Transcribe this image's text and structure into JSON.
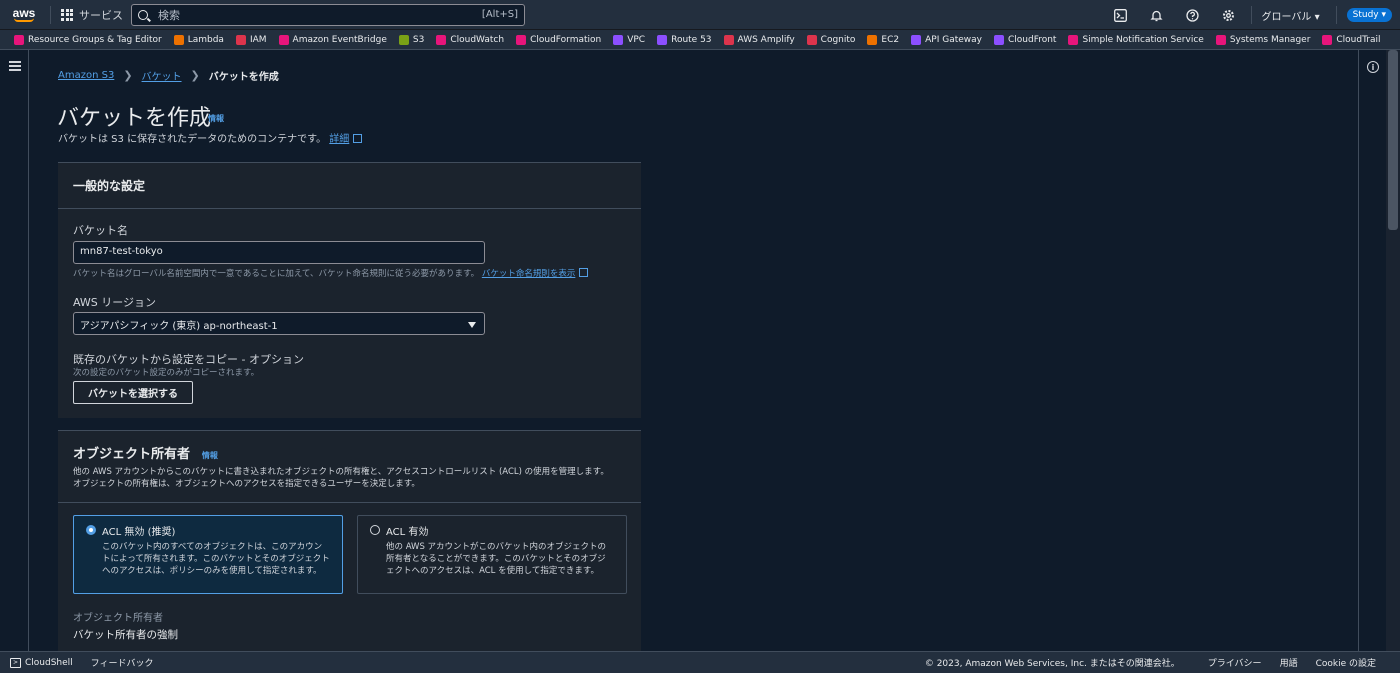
{
  "topnav": {
    "logo": "aws",
    "services_label": "サービス",
    "search_placeholder": "検索",
    "search_shortcut": "[Alt+S]",
    "region": "グローバル ▾",
    "account": "Study ▾",
    "icons": [
      "cloudshell-icon",
      "bell-icon",
      "help-icon",
      "gear-icon"
    ]
  },
  "favorites": [
    {
      "label": "Resource Groups & Tag Editor",
      "color": "#e7157b"
    },
    {
      "label": "Lambda",
      "color": "#ed7100"
    },
    {
      "label": "IAM",
      "color": "#dd344c"
    },
    {
      "label": "Amazon EventBridge",
      "color": "#e7157b"
    },
    {
      "label": "S3",
      "color": "#7aa116"
    },
    {
      "label": "CloudWatch",
      "color": "#e7157b"
    },
    {
      "label": "CloudFormation",
      "color": "#e7157b"
    },
    {
      "label": "VPC",
      "color": "#8c4fff"
    },
    {
      "label": "Route 53",
      "color": "#8c4fff"
    },
    {
      "label": "AWS Amplify",
      "color": "#dd344c"
    },
    {
      "label": "Cognito",
      "color": "#dd344c"
    },
    {
      "label": "EC2",
      "color": "#ed7100"
    },
    {
      "label": "API Gateway",
      "color": "#8c4fff"
    },
    {
      "label": "CloudFront",
      "color": "#8c4fff"
    },
    {
      "label": "Simple Notification Service",
      "color": "#e7157b"
    },
    {
      "label": "Systems Manager",
      "color": "#e7157b"
    },
    {
      "label": "CloudTrail",
      "color": "#e7157b"
    }
  ],
  "breadcrumb": {
    "s3": "Amazon S3",
    "bucket": "バケット",
    "current": "バケットを作成"
  },
  "page": {
    "title": "バケットを作成",
    "info": "情報",
    "desc": "バケットは S3 に保存されたデータのためのコンテナです。",
    "desc_link": "詳細"
  },
  "general": {
    "header": "一般的な設定",
    "bucket_name_label": "バケット名",
    "bucket_name_value": "mn87-test-tokyo",
    "bucket_name_hint": "バケット名はグローバル名前空間内で一意であることに加えて、バケット命名規則に従う必要があります。",
    "bucket_name_hint_link": "バケット命名規則を表示",
    "region_label": "AWS リージョン",
    "region_value": "アジアパシフィック (東京) ap-northeast-1",
    "copy_label": "既存のバケットから設定をコピー - オプション",
    "copy_hint": "次の設定のバケット設定のみがコピーされます。",
    "copy_button": "バケットを選択する"
  },
  "ownership": {
    "header": "オブジェクト所有者",
    "info": "情報",
    "desc1": "他の AWS アカウントからこのバケットに書き込まれたオブジェクトの所有権と、アクセスコントロールリスト (ACL) の使用を管理します。",
    "desc2": "オブジェクトの所有権は、オブジェクトへのアクセスを指定できるユーザーを決定します。",
    "option1_title": "ACL 無効 (推奨)",
    "option1_desc": "このバケット内のすべてのオブジェクトは、このアカウントによって所有されます。このバケットとそのオブジェクトへのアクセスは、ポリシーのみを使用して指定されます。",
    "option2_title": "ACL 有効",
    "option2_desc": "他の AWS アカウントがこのバケット内のオブジェクトの所有者となることができます。このバケットとそのオブジェクトへのアクセスは、ACL を使用して指定できます。",
    "owner_label": "オブジェクト所有者",
    "owner_value": "バケット所有者の強制"
  },
  "footer": {
    "cloudshell": "CloudShell",
    "feedback": "フィードバック",
    "copyright": "© 2023, Amazon Web Services, Inc. またはその関連会社。",
    "privacy": "プライバシー",
    "terms": "用語",
    "cookie": "Cookie の設定"
  }
}
